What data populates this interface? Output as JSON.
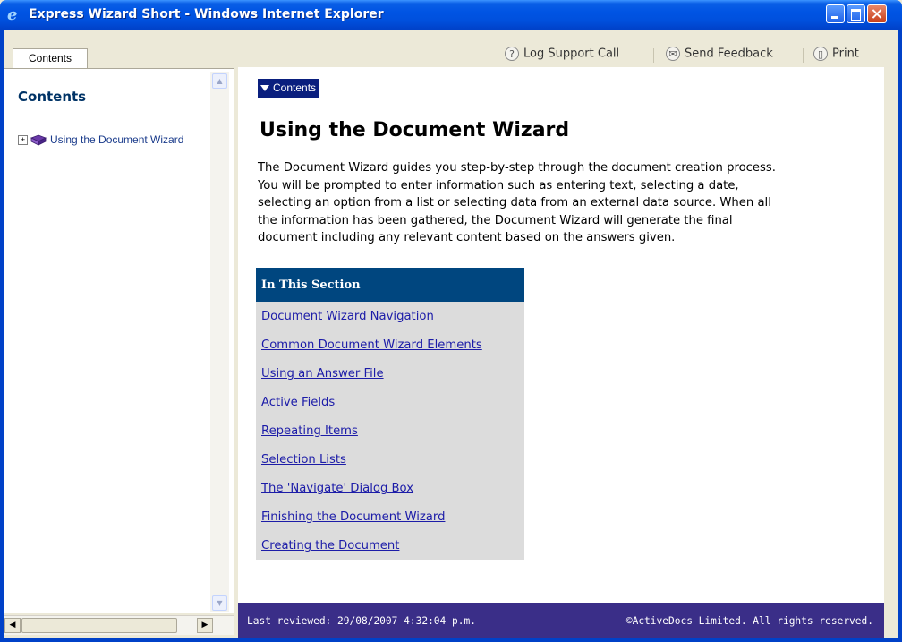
{
  "window": {
    "title": "Express Wizard Short - Windows Internet Explorer"
  },
  "left_pane": {
    "tab_label": "Contents",
    "heading": "Contents",
    "tree_items": [
      {
        "label": "Using the Document Wizard",
        "expander": "⊞",
        "icon": "book-icon"
      }
    ]
  },
  "toolbar": {
    "support_label": "Log Support Call",
    "feedback_label": "Send Feedback",
    "print_label": "Print"
  },
  "content": {
    "contents_button": "Contents",
    "title": "Using the Document Wizard",
    "intro_lines": [
      "The Document Wizard guides you step-by-step through the document creation process.",
      "You will be prompted to enter information such as entering text, selecting a date,",
      "selecting an option from a list or selecting data from an external data source. When all",
      "the information has been gathered, the Document Wizard will generate the final",
      "document including any relevant content based on the answers given."
    ],
    "section_heading": "In This Section",
    "section_links": [
      "Document Wizard Navigation",
      "Common Document Wizard Elements",
      "Using an Answer File",
      "Active Fields",
      "Repeating Items",
      "Selection Lists",
      "The 'Navigate' Dialog Box",
      "Finishing the Document Wizard",
      "Creating the Document"
    ]
  },
  "footer": {
    "last_reviewed": "Last reviewed: 29/08/2007 4:32:04 p.m.",
    "copyright": "©ActiveDocs Limited. All rights reserved."
  },
  "colors": {
    "title_bar": "#0054e3",
    "section_header": "#00467f",
    "footer_bg": "#3a2e88",
    "link": "#1c1ca8",
    "contents_button": "#0a1f7e"
  }
}
